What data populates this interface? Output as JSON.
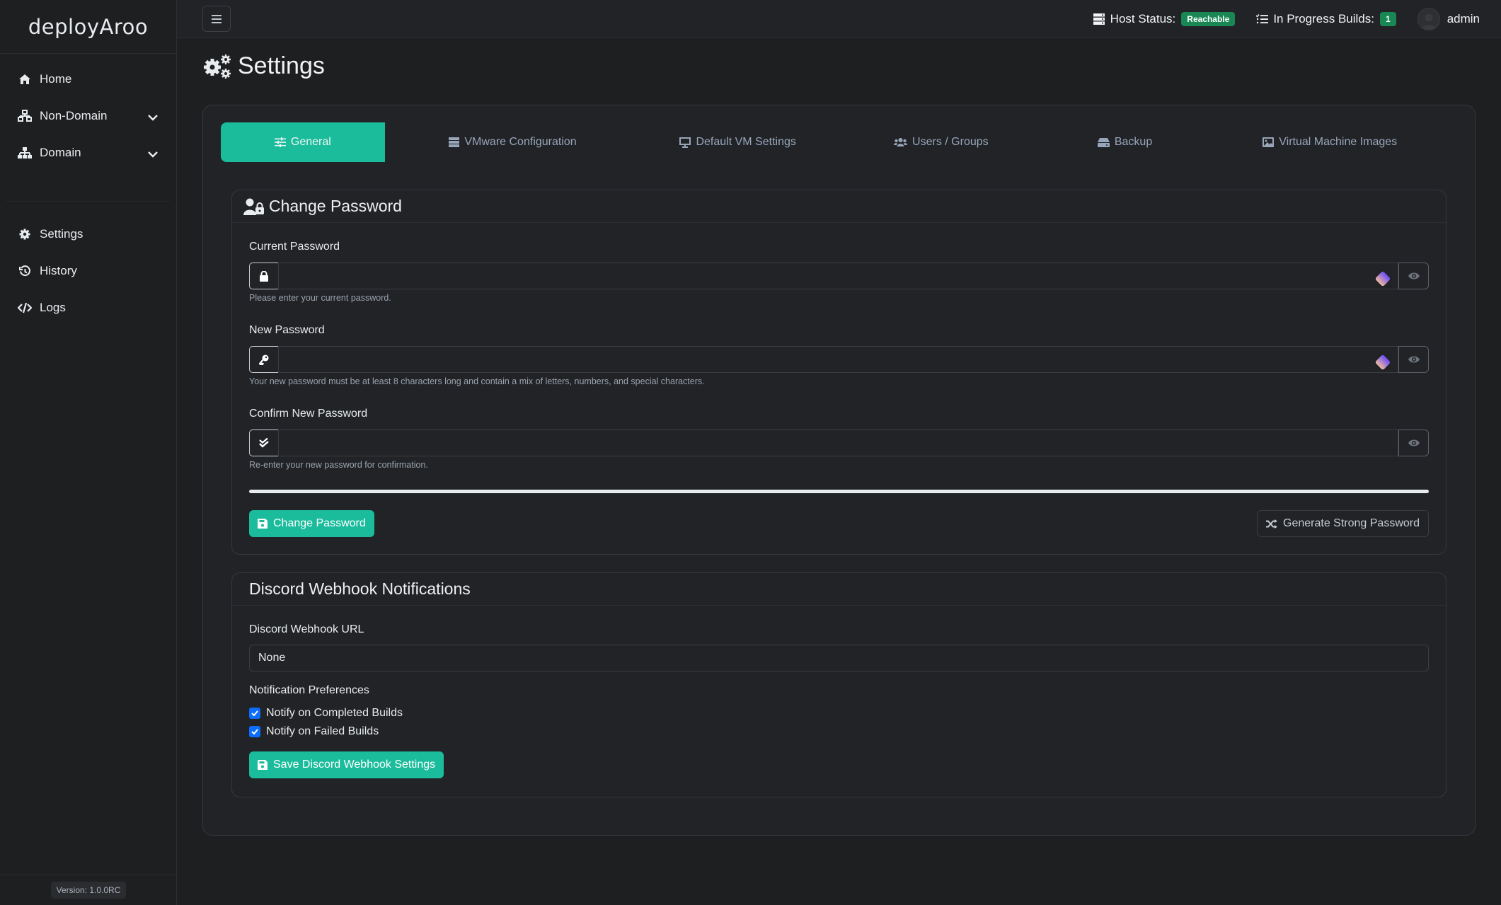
{
  "app": {
    "brand": "deployAroo",
    "version": "Version: 1.0.0RC"
  },
  "sidebar": {
    "items": [
      {
        "label": "Home",
        "icon": "home-icon"
      },
      {
        "label": "Non-Domain",
        "icon": "network-icon",
        "expandable": true
      },
      {
        "label": "Domain",
        "icon": "sitemap-icon",
        "expandable": true
      },
      {
        "label": "Settings",
        "icon": "gear-icon"
      },
      {
        "label": "History",
        "icon": "history-icon"
      },
      {
        "label": "Logs",
        "icon": "code-icon"
      }
    ]
  },
  "topbar": {
    "host_status_label": "Host Status:",
    "host_status_value": "Reachable",
    "builds_label": "In Progress Builds:",
    "builds_count": "1",
    "username": "admin"
  },
  "page": {
    "title": "Settings"
  },
  "tabs": [
    {
      "label": "General",
      "icon": "sliders-icon",
      "active": true
    },
    {
      "label": "VMware Configuration",
      "icon": "server-icon"
    },
    {
      "label": "Default VM Settings",
      "icon": "desktop-icon"
    },
    {
      "label": "Users / Groups",
      "icon": "users-icon"
    },
    {
      "label": "Backup",
      "icon": "hdd-icon"
    },
    {
      "label": "Virtual Machine Images",
      "icon": "image-icon"
    }
  ],
  "change_password": {
    "title": "Change Password",
    "current": {
      "label": "Current Password",
      "value": "",
      "help": "Please enter your current password."
    },
    "new": {
      "label": "New Password",
      "value": "",
      "help": "Your new password must be at least 8 characters long and contain a mix of letters, numbers, and special characters."
    },
    "confirm": {
      "label": "Confirm New Password",
      "value": "",
      "help": "Re-enter your new password for confirmation."
    },
    "strength_percent": 100,
    "submit_label": "Change Password",
    "generate_label": "Generate Strong Password"
  },
  "discord": {
    "title": "Discord Webhook Notifications",
    "url_label": "Discord Webhook URL",
    "url_value": "None",
    "prefs_label": "Notification Preferences",
    "prefs": [
      {
        "label": "Notify on Completed Builds",
        "checked": true
      },
      {
        "label": "Notify on Failed Builds",
        "checked": true
      }
    ],
    "save_label": "Save Discord Webhook Settings"
  },
  "colors": {
    "accent": "#1abc9c",
    "success_badge": "#198754",
    "checkbox": "#0d6efd"
  }
}
